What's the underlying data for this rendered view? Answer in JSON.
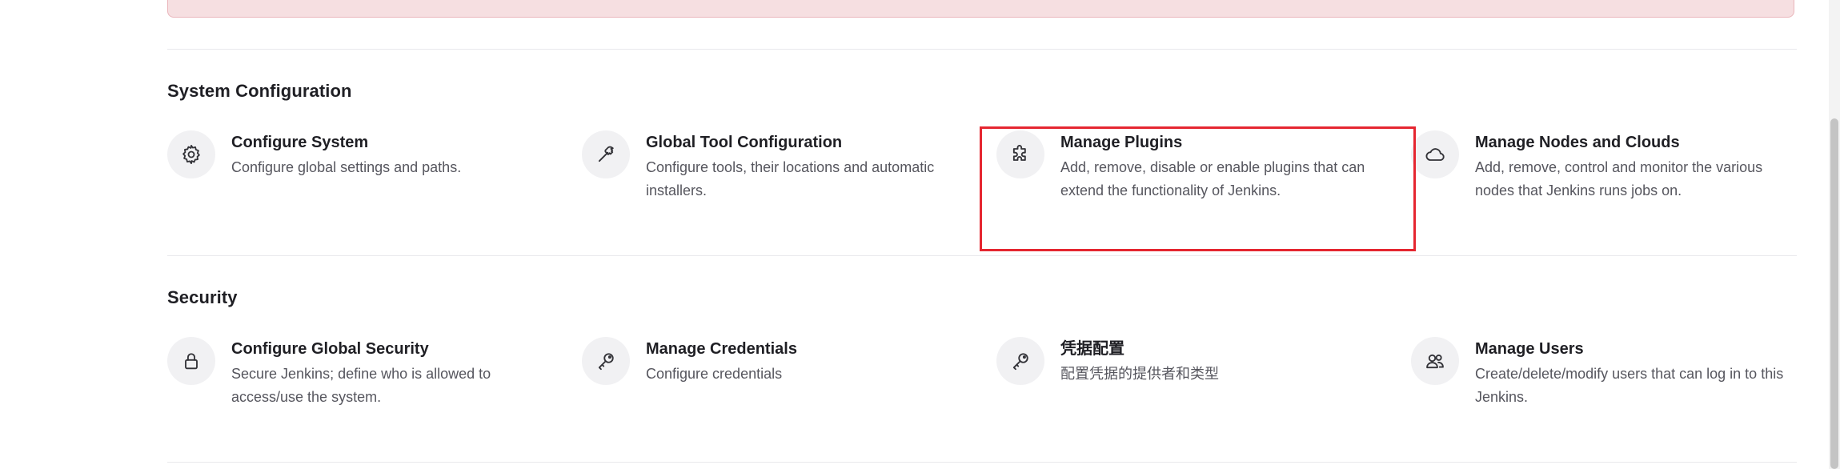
{
  "sections": [
    {
      "title": "System Configuration",
      "items": [
        {
          "icon": "gear-icon",
          "title": "Configure System",
          "description": "Configure global settings and paths."
        },
        {
          "icon": "hammer-icon",
          "title": "Global Tool Configuration",
          "description": "Configure tools, their locations and automatic installers."
        },
        {
          "icon": "puzzle-icon",
          "title": "Manage Plugins",
          "description": "Add, remove, disable or enable plugins that can extend the functionality of Jenkins."
        },
        {
          "icon": "cloud-icon",
          "title": "Manage Nodes and Clouds",
          "description": "Add, remove, control and monitor the various nodes that Jenkins runs jobs on."
        }
      ]
    },
    {
      "title": "Security",
      "items": [
        {
          "icon": "lock-icon",
          "title": "Configure Global Security",
          "description": "Secure Jenkins; define who is allowed to access/use the system."
        },
        {
          "icon": "key-icon",
          "title": "Manage Credentials",
          "description": "Configure credentials"
        },
        {
          "icon": "key-icon",
          "title": "凭据配置",
          "description": "配置凭据的提供者和类型"
        },
        {
          "icon": "users-icon",
          "title": "Manage Users",
          "description": "Create/delete/modify users that can log in to this Jenkins."
        }
      ]
    }
  ],
  "colors": {
    "alert_background": "#f6dfe1",
    "highlight_border": "#e52630",
    "icon_background": "#f1f1f3"
  }
}
